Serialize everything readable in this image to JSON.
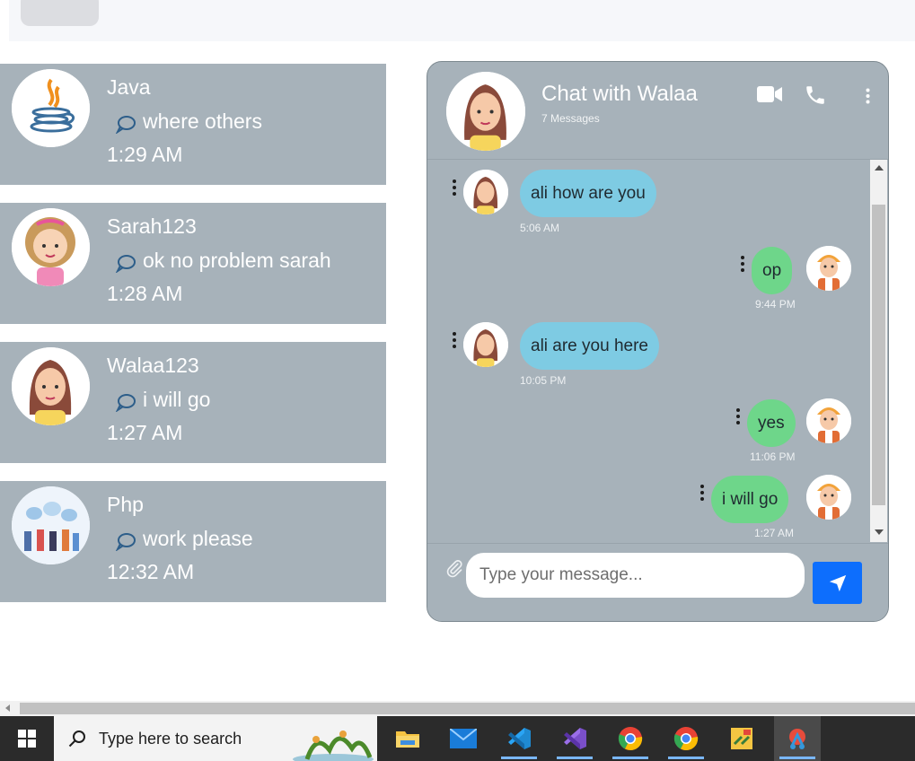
{
  "conversations": [
    {
      "name": "Java",
      "last_message": "where others",
      "time": "1:29 AM",
      "avatar": "java-logo-icon"
    },
    {
      "name": "Sarah123",
      "last_message": "ok no problem sarah",
      "time": "1:28 AM",
      "avatar": "curly-girl-avatar"
    },
    {
      "name": "Walaa123",
      "last_message": "i will go",
      "time": "1:27 AM",
      "avatar": "girl-avatar"
    },
    {
      "name": "Php",
      "last_message": "work please",
      "time": "12:32 AM",
      "avatar": "group-meeting-avatar"
    }
  ],
  "chat": {
    "title": "Chat with Walaa",
    "count": "7 Messages",
    "messages": [
      {
        "direction": "in",
        "text": "ali how are you",
        "time": "5:06 AM"
      },
      {
        "direction": "out",
        "text": "op",
        "time": "9:44 PM"
      },
      {
        "direction": "in",
        "text": "ali are you here",
        "time": "10:05 PM"
      },
      {
        "direction": "out",
        "text": "yes",
        "time": "11:06 PM"
      },
      {
        "direction": "out",
        "text": "i will go",
        "time": "1:27 AM"
      }
    ],
    "input_placeholder": "Type your message..."
  },
  "taskbar": {
    "search_placeholder": "Type here to search",
    "apps": [
      "file-explorer-icon",
      "mail-icon",
      "vscode-icon",
      "visual-studio-icon",
      "chrome-icon",
      "chrome-icon",
      "tool-icon",
      "app-icon"
    ]
  },
  "colors": {
    "panel": "#a7b2ba",
    "incoming_bubble": "#7ecbe3",
    "outgoing_bubble": "#6ed68a",
    "send_button": "#0d6efd"
  }
}
